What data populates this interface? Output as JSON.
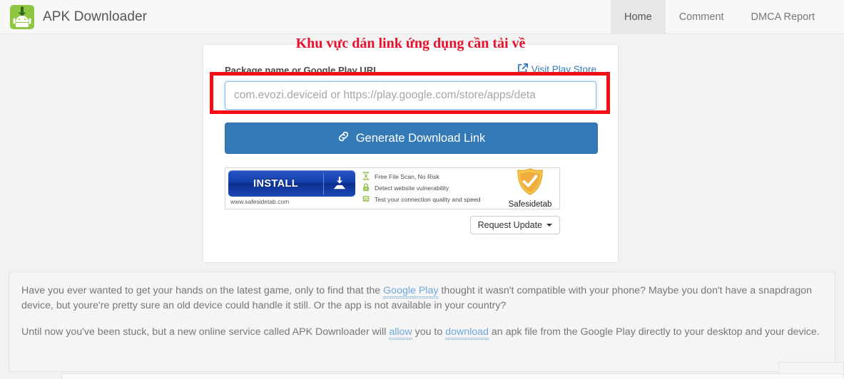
{
  "navbar": {
    "brand": "APK Downloader",
    "logo_icon": "android-download-logo",
    "items": [
      {
        "label": "Home",
        "active": true
      },
      {
        "label": "Comment",
        "active": false
      },
      {
        "label": "DMCA Report",
        "active": false
      }
    ]
  },
  "annotation": {
    "text": "Khu vực dán link ứng dụng cần tải về",
    "color": "#e8112d",
    "highlight_box_color": "#f40d15"
  },
  "form": {
    "label": "Package name or Google Play URL",
    "play_store_link": "Visit Play Store",
    "play_store_icon": "external-link-icon",
    "input_value": "",
    "input_placeholder": "com.evozi.deviceid or https://play.google.com/store/apps/deta",
    "generate_button": "Generate Download Link",
    "generate_icon": "link-chain-icon",
    "request_update_button": "Request Update",
    "request_update_icon": "caret-down-icon"
  },
  "ad": {
    "install_label": "INSTALL",
    "install_icon": "download-tray-icon",
    "url": "www.safesidetab.com",
    "features": [
      {
        "icon": "scanner-icon",
        "text": "Free File Scan, No Risk"
      },
      {
        "icon": "padlock-icon",
        "text": "Detect website vulnerability"
      },
      {
        "icon": "speed-meter-icon",
        "text": "Test your connection quality and speed"
      }
    ],
    "brand": "Safesidetab",
    "brand_icon": "shield-check-icon"
  },
  "description": {
    "p1_a": "Have you ever wanted to get your hands on the latest game, only to find that the ",
    "p1_link": "Google Play",
    "p1_b": " thought it wasn't compatible with your phone? Maybe you don't have a snapdragon device, but youre're pretty sure an old device could handle it still. Or the app is not available in your country?",
    "p2_a": "Until now you've been stuck, but a new online service called APK Downloader will ",
    "p2_link1": "allow",
    "p2_b": " you to ",
    "p2_link2": "download",
    "p2_c": " an apk file from the Google Play directly to your desktop and your device."
  },
  "colors": {
    "primary": "#337ab7",
    "brand_green": "#8ec63f",
    "link": "#6fa8dc",
    "annotation_red": "#e8112d"
  }
}
